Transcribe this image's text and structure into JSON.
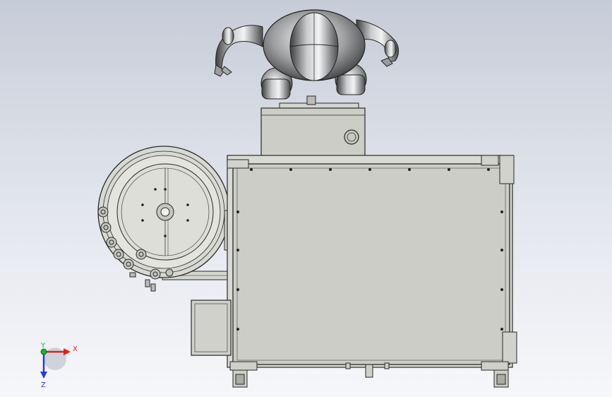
{
  "triad": {
    "x_label": "X",
    "y_label": "Y",
    "z_label": "Z",
    "colors": {
      "x": "#e02020",
      "y": "#1fae2f",
      "z": "#2a3bd8"
    }
  },
  "palette": {
    "background_top": "#c6ccd8",
    "background_bottom": "#f6f7fa",
    "machine_panel": "#cbcdc6",
    "outline": "#2a2a2a",
    "robot_metal": "#8a8c8e"
  }
}
